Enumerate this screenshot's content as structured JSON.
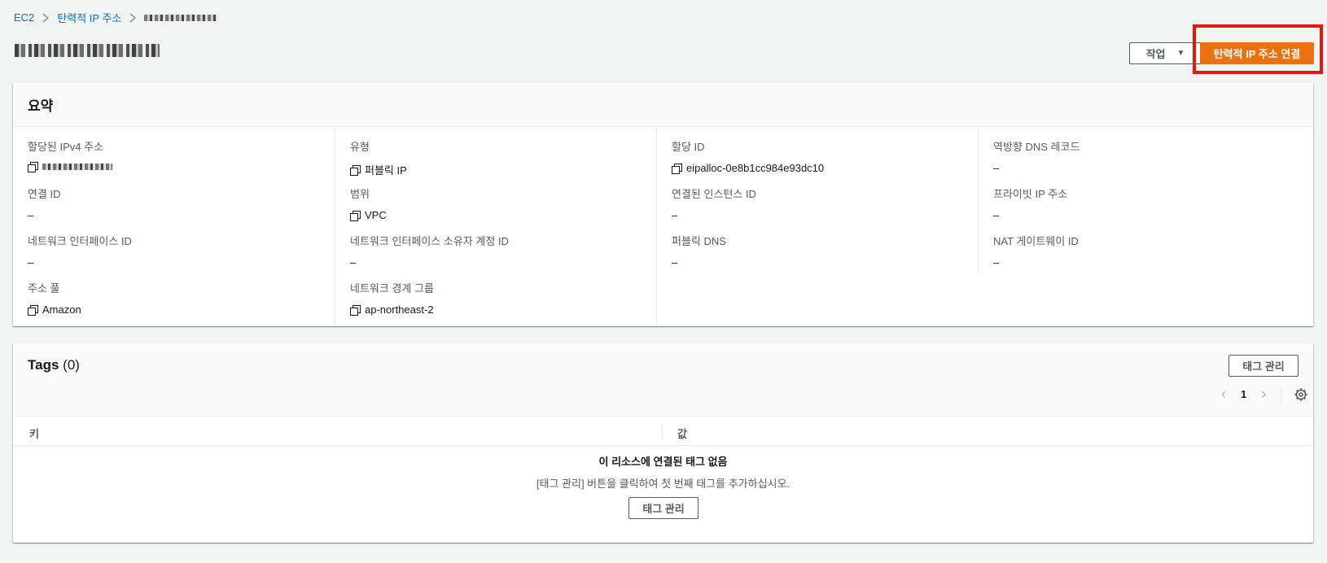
{
  "breadcrumb": {
    "root": "EC2",
    "section": "탄력적 IP 주소"
  },
  "header": {
    "actions_label": "작업",
    "associate_label": "탄력적 IP 주소 연결"
  },
  "summary": {
    "title": "요약",
    "fields": [
      {
        "label": "할당된 IPv4 주소",
        "value": ""
      },
      {
        "label": "연결 ID",
        "value": "–"
      },
      {
        "label": "네트워크 인터페이스 ID",
        "value": "–"
      },
      {
        "label": "주소 풀",
        "value": "Amazon"
      },
      {
        "label": "유형",
        "value": "퍼블릭 IP"
      },
      {
        "label": "범위",
        "value": "VPC"
      },
      {
        "label": "네트워크 인터페이스 소유자 계정 ID",
        "value": "–"
      },
      {
        "label": "네트워크 경계 그룹",
        "value": "ap-northeast-2"
      },
      {
        "label": "할당 ID",
        "value": "eipalloc-0e8b1cc984e93dc10"
      },
      {
        "label": "연결된 인스턴스 ID",
        "value": "–"
      },
      {
        "label": "퍼블릭 DNS",
        "value": "–"
      },
      {
        "label": "역방향 DNS 레코드",
        "value": "–"
      },
      {
        "label": "프라이빗 IP 주소",
        "value": "–"
      },
      {
        "label": "NAT 게이트웨이 ID",
        "value": "–"
      }
    ]
  },
  "tags": {
    "title": "Tags",
    "count": "(0)",
    "manage_label": "태그 관리",
    "page": "1",
    "col_key": "키",
    "col_value": "값",
    "empty_title": "이 리소스에 연결된 태그 없음",
    "empty_desc": "[태그 관리] 버튼을 클릭하여 첫 번째 태그를 추가하십시오.",
    "empty_button": "태그 관리"
  },
  "colors": {
    "primary": "#ec7211",
    "link": "#0073bb",
    "highlight": "#e0180f"
  }
}
